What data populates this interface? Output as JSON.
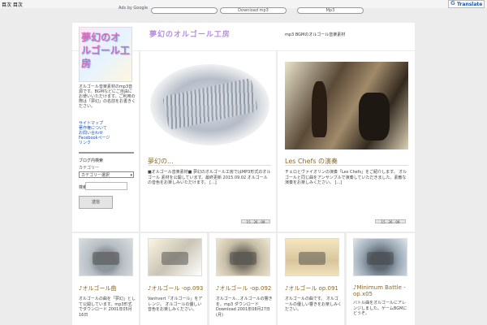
{
  "topbar": {
    "text": "目次 目次"
  },
  "ads": {
    "label": "Ads by Google",
    "pills": [
      "",
      "Download mp3",
      "Mp3"
    ]
  },
  "translate": {
    "label": "Translate",
    "icon": "google-g-icon"
  },
  "header": {
    "logo_text": "夢幻のオルゴール工房",
    "title": "夢幻のオルゴール工房",
    "tagline": "mp3 BGMのオルゴール音楽素材"
  },
  "sidebar": {
    "description": "オルゴール音楽素材のmp3音源です。BGMなどにご自由にお使いいただけます。ご利用の際は「夢幻」の名前をお書きください。",
    "links": [
      "サイトマップ",
      "著作権について",
      "お問い合わせ",
      "Facebookページ",
      "リンク"
    ],
    "search_heading": "ブログ内検索",
    "search_sub": "カテゴリー",
    "select_value": "カテゴリー選択",
    "keyword_label": "検索",
    "submit_label": "送信"
  },
  "featured": [
    {
      "title": "夢幻の...",
      "excerpt": "■オルゴール音楽素材■ 夢幻のオルゴール工房ではMP3形式のオルゴール 素材を公開しています。最終更新 2015.09.02 オルゴールの音色をお楽しみいただけます。 [...]",
      "date": "15 . 26 . 09 "
    },
    {
      "title": "Les Chefs の演奏",
      "excerpt": "チェロとヴァイオリンの演奏「Les Chefs」をご紹介します。 オルゴールと同じ曲をアンサンブルで演奏していただきました。素敵な演奏をお楽しみください。 [...]",
      "date": "15 . 26 . 09 "
    }
  ],
  "posts": [
    {
      "title": "♪オルゴール曲",
      "excerpt": "オルゴールの曲を「夢幻」として公開しています。mp3形式でダウンロード 2001年05月16日"
    },
    {
      "title": "♪オルゴール -op.093",
      "excerpt": "Vanhvert「オルゴール」をアレンジ。 オルゴールの優しい音色をお楽しみください。"
    },
    {
      "title": "♪オルゴール -op.092",
      "excerpt": "オルゴール...オルゴールの響きを。mp3 ダウンロード Download 2001年08月27日(月)"
    },
    {
      "title": "♪オルゴール op.091",
      "excerpt": "オルゴールの曲です。 オルゴールの優しい響きをお楽しみください。"
    },
    {
      "title": "♪Minimum Battle -op.x05",
      "excerpt": "バトル曲をオルゴールにアレンジしました。ゲームBGMにどうぞ。"
    }
  ]
}
